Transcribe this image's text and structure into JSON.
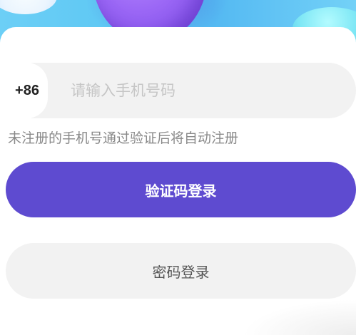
{
  "phone": {
    "country_code": "+86",
    "placeholder": "请输入手机号码",
    "value": ""
  },
  "hint": "未注册的手机号通过验证后将自动注册",
  "buttons": {
    "sms_login": "验证码登录",
    "password_login": "密码登录"
  },
  "colors": {
    "primary": "#5e4bd0",
    "input_bg": "#f2f2f2"
  }
}
